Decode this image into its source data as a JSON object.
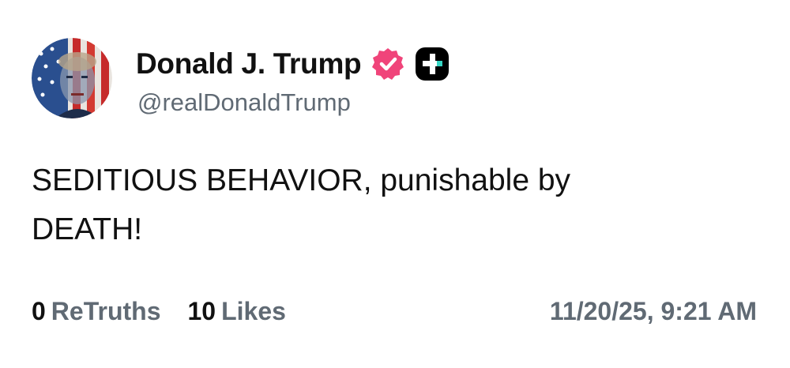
{
  "author": {
    "display_name": "Donald J. Trump",
    "handle": "@realDonaldTrump",
    "avatar_icon": "avatar-flag-portrait",
    "verified_badge_icon": "verified-badge-icon",
    "verified_color": "#f0447a",
    "app_badge_icon": "truth-social-badge-icon",
    "app_badge_colors": [
      "#000000",
      "#ffffff",
      "#35d6c4"
    ]
  },
  "post": {
    "text_line1": "SEDITIOUS BEHAVIOR, punishable by",
    "text_line2": "DEATH!"
  },
  "stats": {
    "retruths_count": "0",
    "retruths_label": "ReTruths",
    "likes_count": "10",
    "likes_label": "Likes"
  },
  "timestamp": "11/20/25, 9:21 AM"
}
